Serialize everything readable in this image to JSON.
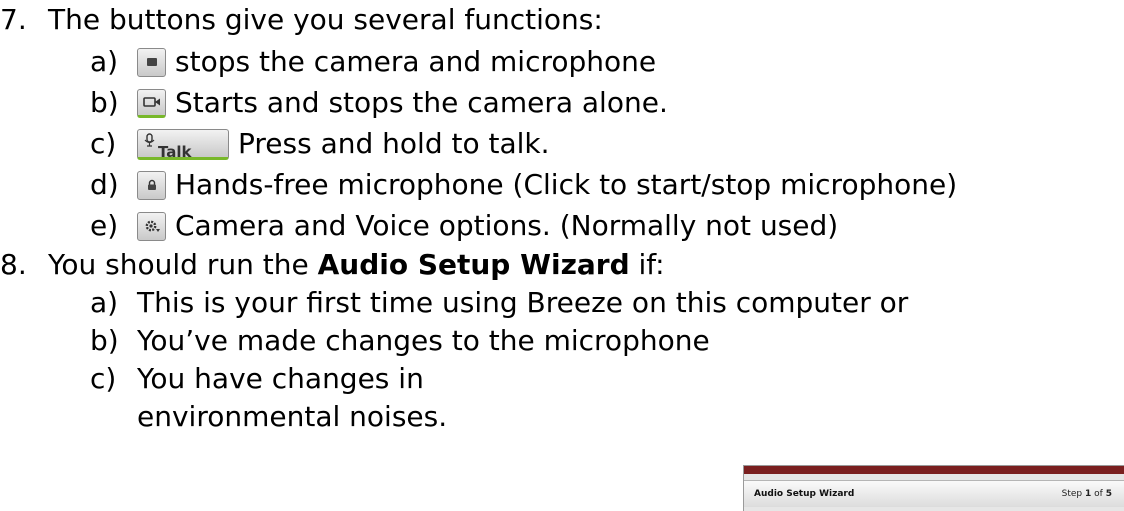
{
  "lines": {
    "l7": {
      "num": "7.",
      "text": "The buttons give you several functions:"
    },
    "l7a": {
      "num": "a)",
      "text": "stops the camera and microphone"
    },
    "l7b": {
      "num": "b)",
      "text": "Starts and stops the camera alone."
    },
    "l7c": {
      "num": "c)",
      "text": "Press and hold to talk."
    },
    "l7d": {
      "num": "d)",
      "text": "Hands-free microphone (Click to start/stop microphone)"
    },
    "l7e": {
      "num": "e)",
      "text": "Camera and Voice options. (Normally not used)"
    },
    "l8": {
      "num": "8.",
      "pre": "You should run the ",
      "bold": "Audio Setup Wizard",
      "post": " if:"
    },
    "l8a": {
      "num": "a)",
      "text": "This is your first time using Breeze on this computer or"
    },
    "l8b": {
      "num": "b)",
      "text": "You’ve made changes to the microphone"
    },
    "l8c": {
      "num": "c)",
      "text": "You have changes in"
    },
    "l8c2": {
      "text": "environmental noises."
    }
  },
  "icons": {
    "stop": "stop-icon",
    "camera": "camera-icon",
    "talk": "talk-icon",
    "talk_label": "Talk",
    "handsfree": "lock-icon",
    "options": "gear-icon"
  },
  "wizard": {
    "title": "Audio Setup Wizard",
    "step_word": "Step",
    "step_current": "1",
    "step_of": "of",
    "step_total": "5"
  },
  "colors": {
    "accent_green": "#78b82a",
    "wizard_header": "#7a1f1f"
  }
}
